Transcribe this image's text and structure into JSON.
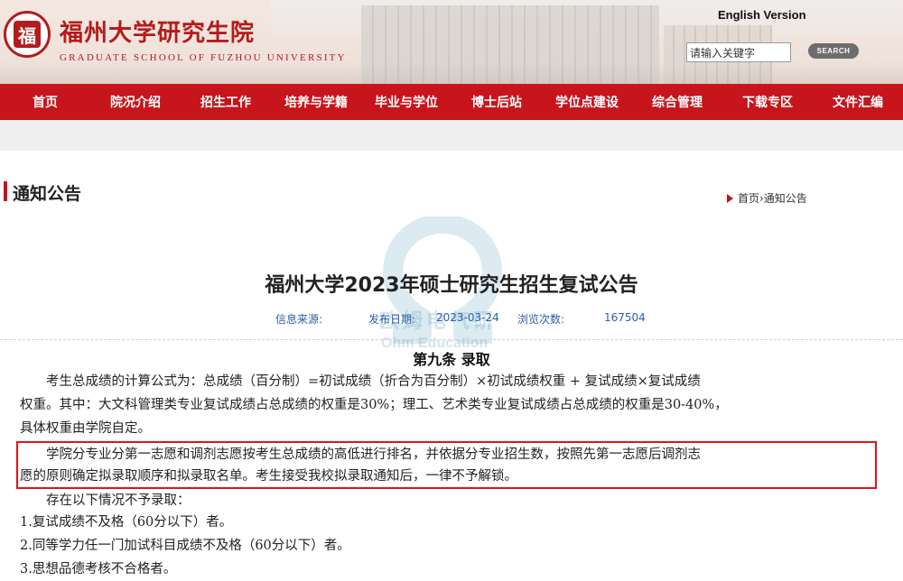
{
  "header": {
    "seal_char": "福",
    "logo_cn": "福州大学研究生院",
    "logo_en": "GRADUATE SCHOOL OF FUZHOU UNIVERSITY",
    "english_version": "English Version",
    "search_placeholder": "请输入关键字",
    "search_button": "SEARCH"
  },
  "nav": [
    "首页",
    "院况介绍",
    "招生工作",
    "培养与学籍",
    "毕业与学位",
    "博士后站",
    "学位点建设",
    "综合管理",
    "下载专区",
    "文件汇编"
  ],
  "section": {
    "title": "通知公告",
    "breadcrumb": "首页›通知公告"
  },
  "watermark": {
    "cn": "欧姆电气研",
    "en": "Ohm Education"
  },
  "article": {
    "title": "福州大学2023年硕士研究生招生复试公告",
    "meta": {
      "source_label": "信息来源:",
      "publish_label": "发布日期:",
      "publish_date": "2023-03-24",
      "views_label": "浏览次数:",
      "views": "167504"
    },
    "clause_title": "第九条 录取",
    "lines": [
      "　　考生总成绩的计算公式为：总成绩（百分制）=初试成绩（折合为百分制）×初试成绩权重 + 复试成绩×复试成绩",
      "权重。其中：大文科管理类专业复试成绩占总成绩的权重是30%；理工、艺术类专业复试成绩占总成绩的权重是30-40%，",
      "具体权重由学院自定。",
      "　　学院分专业分第一志愿和调剂志愿按考生总成绩的高低进行排名，并依据分专业招生数，按照先第一志愿后调剂志",
      "愿的原则确定拟录取顺序和拟录取名单。考生接受我校拟录取通知后，一律不予解锁。",
      "　　存在以下情况不予录取：",
      "1.复试成绩不及格（60分以下）者。",
      "2.同等学力任一门加试科目成绩不及格（60分以下）者。",
      "3.思想品德考核不合格者。"
    ]
  },
  "colors": {
    "brand_red": "#c8141b",
    "link_blue": "#2d5da8"
  }
}
